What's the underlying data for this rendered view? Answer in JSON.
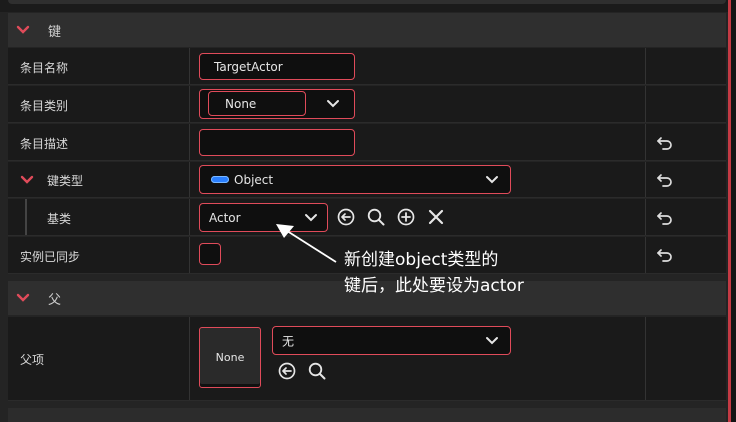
{
  "sections": {
    "key": {
      "title": "键"
    },
    "parent": {
      "title": "父"
    }
  },
  "rows": {
    "entry_name": {
      "label": "条目名称",
      "value": "TargetActor"
    },
    "entry_category": {
      "label": "条目类别",
      "value": "None"
    },
    "entry_description": {
      "label": "条目描述",
      "value": ""
    },
    "key_type": {
      "label": "键类型",
      "value": "Object"
    },
    "base_class": {
      "label": "基类",
      "value": "Actor"
    },
    "instance_synced": {
      "label": "实例已同步",
      "checked": false
    },
    "parent_item": {
      "label": "父项",
      "thumbnail": "None",
      "value": "无"
    }
  },
  "annotation": {
    "line1": "新创建object类型的",
    "line2": "键后，此处要设为actor"
  },
  "colors": {
    "accent": "#e04b5a",
    "panel": "#1a1a1a",
    "section": "#2f2f2f"
  }
}
